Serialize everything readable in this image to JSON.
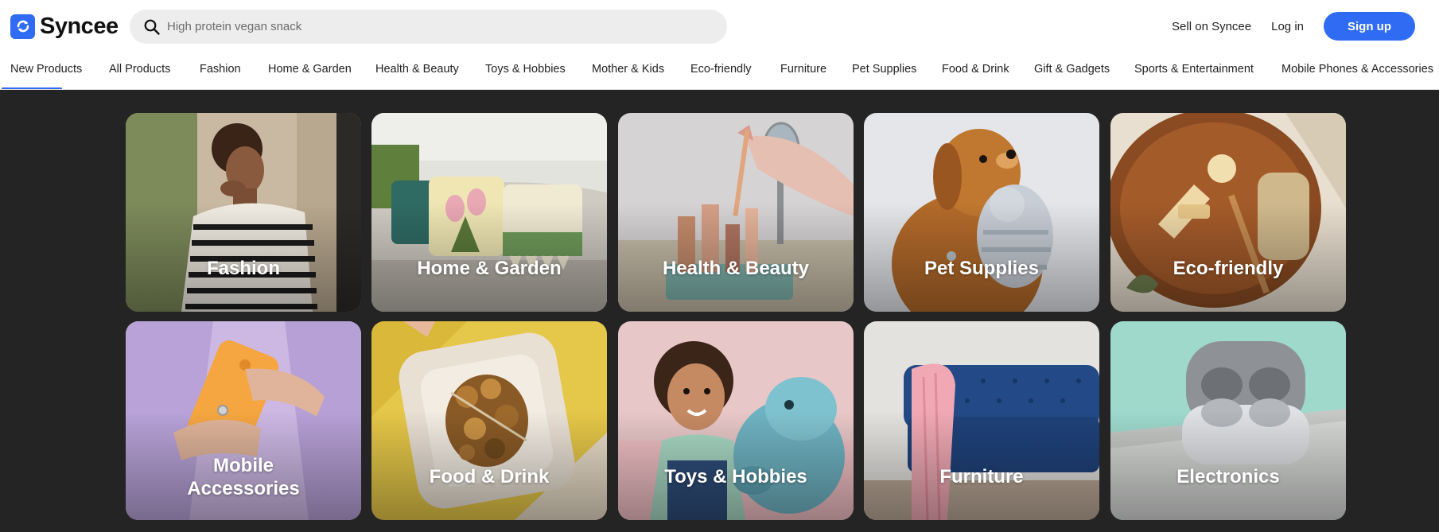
{
  "brand": {
    "name": "Syncee",
    "icon": "sync-arrows-icon",
    "color": "#2f6bf3"
  },
  "search": {
    "placeholder": "High protein vegan snack",
    "icon": "search-icon"
  },
  "header": {
    "sell_label": "Sell on Syncee",
    "login_label": "Log in",
    "signup_label": "Sign up"
  },
  "category_nav": {
    "active": "New Products",
    "items": [
      "New Products",
      "All Products",
      "Fashion",
      "Home & Garden",
      "Health & Beauty",
      "Toys & Hobbies",
      "Mother & Kids",
      "Eco-friendly",
      "Furniture",
      "Pet Supplies",
      "Food & Drink",
      "Gift & Gadgets",
      "Sports & Entertainment",
      "Mobile Phones & Accessories"
    ]
  },
  "tiles": [
    {
      "label": "Fashion"
    },
    {
      "label": "Home & Garden"
    },
    {
      "label": "Health & Beauty"
    },
    {
      "label": "Pet Supplies"
    },
    {
      "label": "Eco-friendly"
    },
    {
      "label_line1": "Mobile",
      "label_line2": "Accessories"
    },
    {
      "label": "Food & Drink"
    },
    {
      "label": "Toys & Hobbies"
    },
    {
      "label": "Furniture"
    },
    {
      "label": "Electronics"
    }
  ]
}
